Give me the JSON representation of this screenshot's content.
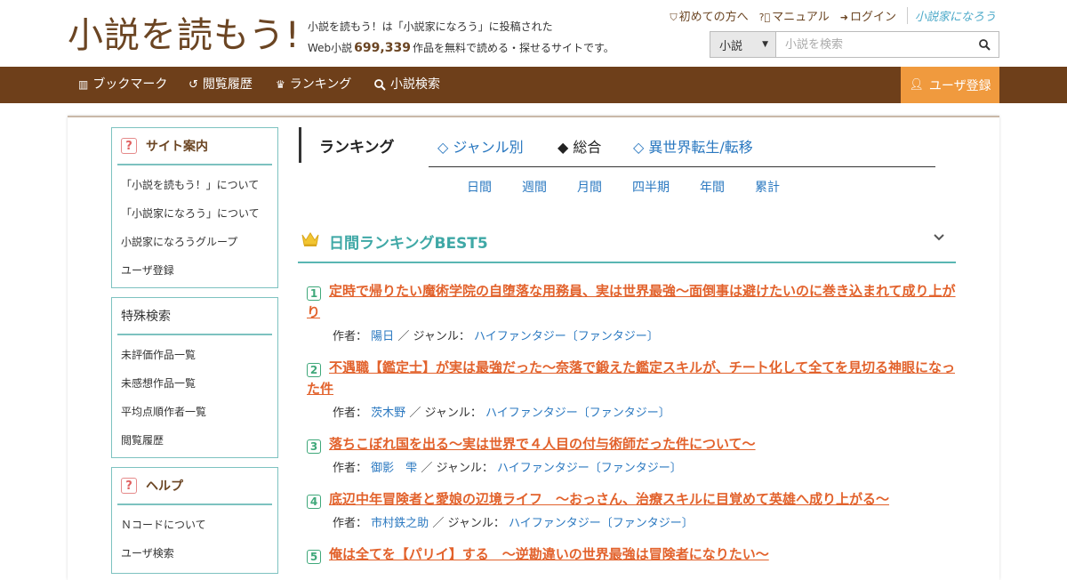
{
  "header": {
    "logo_text": "小説を読もう!",
    "tagline_line1": "小説を読もう！は「小説家になろう」に投稿された",
    "tagline_prefix": "Web小説",
    "tagline_count": "699,339",
    "tagline_suffix": "作品を無料で読める・探せるサイトです。",
    "links": {
      "first_time": "初めての方へ",
      "manual": "マニュアル",
      "login": "ログイン",
      "narou_logo": "小説家になろう"
    },
    "search": {
      "category": "小説",
      "placeholder": "小説を検索"
    }
  },
  "nav": {
    "bookmark": "ブックマーク",
    "history": "閲覧履歴",
    "ranking": "ランキング",
    "search": "小説検索",
    "register": "ユーザ登録"
  },
  "sidebar": {
    "site_guide": {
      "title": "サイト案内",
      "items": [
        "「小説を読もう！」について",
        "「小説家になろう」について",
        "小説家になろうグループ",
        "ユーザ登録"
      ]
    },
    "special_search": {
      "title": "特殊検索",
      "items": [
        "未評価作品一覧",
        "未感想作品一覧",
        "平均点順作者一覧",
        "閲覧履歴"
      ]
    },
    "help": {
      "title": "ヘルプ",
      "items": [
        "Ｎコードについて",
        "ユーザ検索"
      ]
    }
  },
  "ranking": {
    "heading": "ランキング",
    "tabs": {
      "genre": "◇ ジャンル別",
      "overall": "◆ 総合",
      "isekai": "◇ 異世界転生/転移"
    },
    "periods": [
      "日間",
      "週間",
      "月間",
      "四半期",
      "年間",
      "累計"
    ],
    "best_title": "日間ランキングBEST5",
    "labels": {
      "author": "作者：",
      "sep": "／",
      "genre": "ジャンル："
    },
    "entries": [
      {
        "rank": "1",
        "title": "定時で帰りたい魔術学院の自堕落な用務員、実は世界最強～面倒事は避けたいのに巻き込まれて成り上がり",
        "author": "陽日",
        "genre": "ハイファンタジー〔ファンタジー〕"
      },
      {
        "rank": "2",
        "title": "不遇職【鑑定士】が実は最強だった〜奈落で鍛えた鑑定スキルが、チート化して全てを見切る神眼になった件",
        "author": "茨木野",
        "genre": "ハイファンタジー〔ファンタジー〕"
      },
      {
        "rank": "3",
        "title": "落ちこぼれ国を出る〜実は世界で４人目の付与術師だった件について〜",
        "author": "御影　雫",
        "genre": "ハイファンタジー〔ファンタジー〕"
      },
      {
        "rank": "4",
        "title": "底辺中年冒険者と愛娘の辺境ライフ　〜おっさん、治療スキルに目覚めて英雄へ成り上がる〜",
        "author": "市村鉄之助",
        "genre": "ハイファンタジー〔ファンタジー〕"
      },
      {
        "rank": "5",
        "title": "俺は全てを【パリイ】する　〜逆勘違いの世界最強は冒険者になりたい〜",
        "author": "",
        "genre": ""
      }
    ]
  },
  "colors": {
    "brand_brown": "#6e3f1a",
    "register_orange": "#f09a3e",
    "accent_teal": "#59b6b3",
    "title_orange": "#e2622c",
    "link_blue": "#2a78c0"
  }
}
